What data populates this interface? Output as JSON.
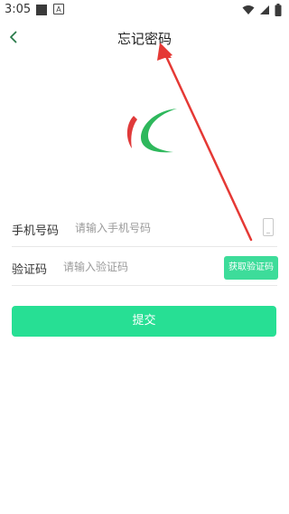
{
  "status_bar": {
    "time": "3:05",
    "a_icon": "A",
    "icons": [
      "notification-square-icon",
      "a-icon",
      "wifi-icon",
      "signal-icon",
      "battery-icon"
    ]
  },
  "header": {
    "title": "忘记密码",
    "back_icon": "chevron-left-icon"
  },
  "form": {
    "phone": {
      "label": "手机号码",
      "placeholder": "请输入手机号码",
      "value": ""
    },
    "code": {
      "label": "验证码",
      "placeholder": "请输入验证码",
      "value": "",
      "get_code_label": "获取验证码"
    },
    "submit_label": "提交"
  },
  "colors": {
    "accent": "#27df94",
    "get_code_button": "#3ddc9a",
    "logo_red": "#e03a3a",
    "logo_green": "#2eb85c",
    "annotation_arrow": "#e53935"
  }
}
